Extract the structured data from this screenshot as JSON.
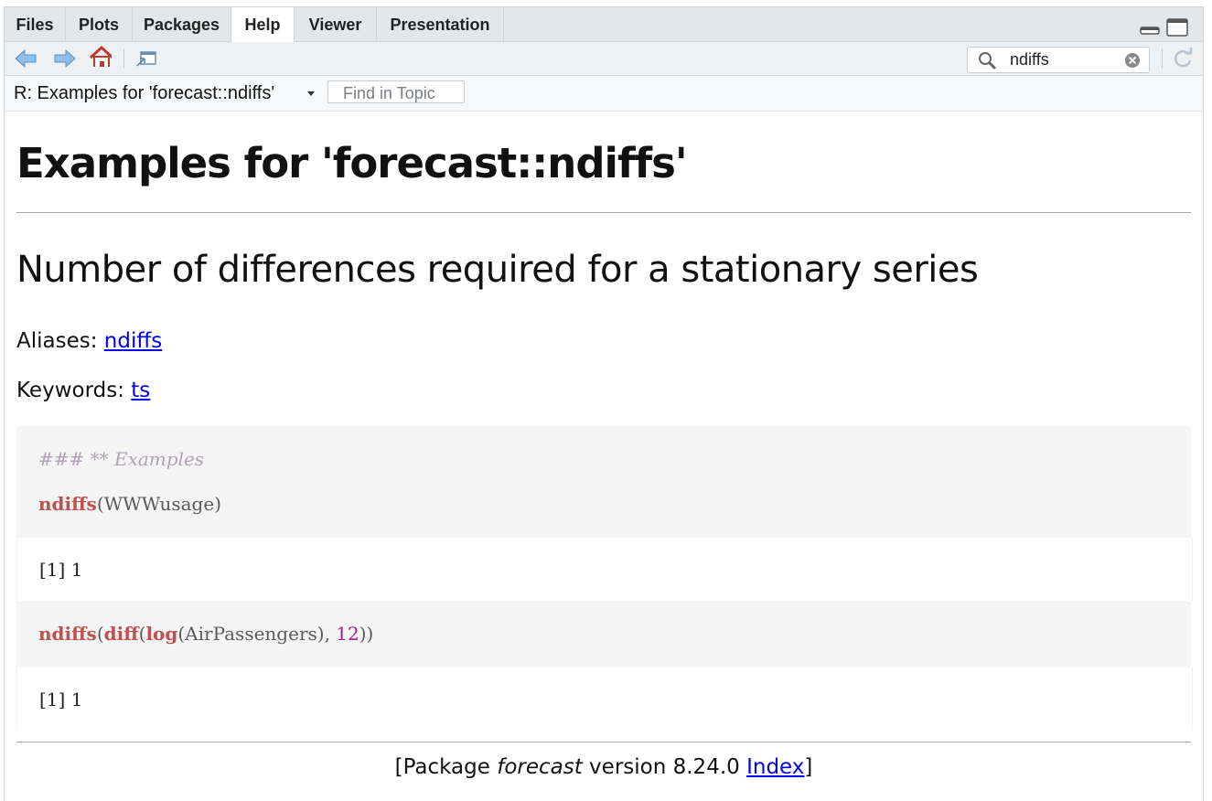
{
  "tabs": [
    {
      "label": "Files",
      "active": false
    },
    {
      "label": "Plots",
      "active": false
    },
    {
      "label": "Packages",
      "active": false
    },
    {
      "label": "Help",
      "active": true
    },
    {
      "label": "Viewer",
      "active": false
    },
    {
      "label": "Presentation",
      "active": false
    }
  ],
  "toolbar": {
    "search_value": "ndiffs"
  },
  "topic_bar": {
    "title": "R: Examples for 'forecast::ndiffs'",
    "find_placeholder": "Find in Topic"
  },
  "doc": {
    "heading": "Examples for 'forecast::ndiffs'",
    "subheading": "Number of differences required for a stationary series",
    "aliases_label": "Aliases:",
    "aliases_link": "ndiffs",
    "keywords_label": "Keywords:",
    "keywords_link": "ts",
    "code": {
      "comment": "### ** Examples",
      "line1_fn": "ndiffs",
      "line1_open": "(",
      "line1_arg": "WWWusage",
      "line1_close": ")",
      "output1": "[1] 1",
      "line2_fn1": "ndiffs",
      "line2_p1": "(",
      "line2_fn2": "diff",
      "line2_p2": "(",
      "line2_fn3": "log",
      "line2_p3": "(",
      "line2_arg": "AirPassengers",
      "line2_p4": "), ",
      "line2_num": "12",
      "line2_p5": "))",
      "output2": "[1] 1"
    },
    "footer": {
      "prefix": "[Package ",
      "package": "forecast",
      "version_text": " version 8.24.0 ",
      "index_link": "Index",
      "suffix": "]"
    }
  },
  "colors": {
    "link": "#0000ee",
    "code_fn": "#c0504d",
    "code_number": "#a3208c",
    "code_comment": "#b0a4b4"
  }
}
